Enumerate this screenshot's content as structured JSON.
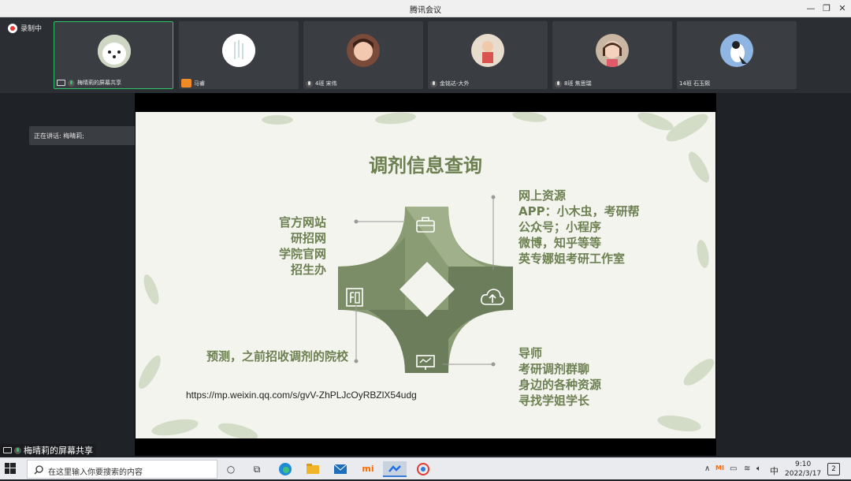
{
  "window": {
    "title": "腾讯会议"
  },
  "recording": {
    "label": "录制中"
  },
  "participants": [
    {
      "name": "梅晴莉的屏幕共享",
      "active": true
    },
    {
      "name": "马睿",
      "active": false
    },
    {
      "name": "4班 宋伟",
      "active": false
    },
    {
      "name": "金铭达-大外",
      "active": false
    },
    {
      "name": "8班 焦思瑞",
      "active": false
    },
    {
      "name": "14班 石玉熙",
      "active": false
    }
  ],
  "speaking": {
    "label": "正在讲话: 梅晴莉;"
  },
  "slide": {
    "title": "调剂信息查询",
    "top_left": [
      "官方网站",
      "研招网",
      "学院官网",
      "招生办"
    ],
    "top_right": [
      "网上资源",
      "APP：小木虫，考研帮",
      "公众号；小程序",
      "微博，知乎等等",
      "英专娜姐考研工作室"
    ],
    "bottom_left": [
      "预测，之前招收调剂的院校"
    ],
    "bottom_right": [
      "导师",
      "考研调剂群聊",
      "身边的各种资源",
      "寻找学姐学长"
    ],
    "url": "https://mp.weixin.qq.com/s/gvV-ZhPLJcOyRBZlX54udg"
  },
  "share_banner": {
    "label": "梅晴莉的屏幕共享"
  },
  "taskbar": {
    "search_placeholder": "在这里输入你要搜索的内容",
    "time": "9:10",
    "date": "2022/3/17",
    "ime": "中",
    "notifications": "2"
  },
  "colors": {
    "slide_green": "#6d8052",
    "shape_dark": "#6b7d5b",
    "shape_light": "#9aab86",
    "active_border": "#2fc36a"
  }
}
